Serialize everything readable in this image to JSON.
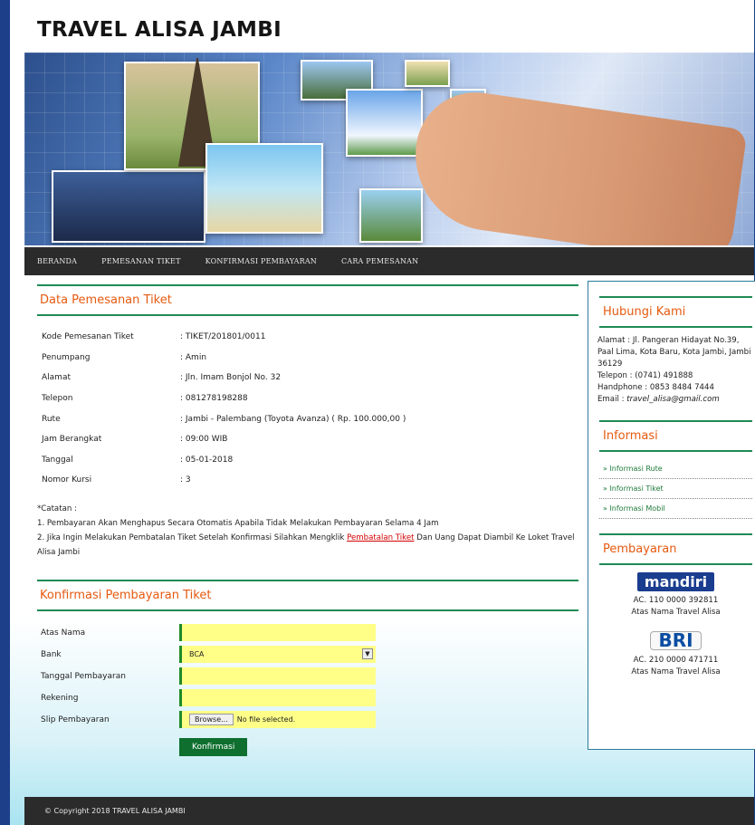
{
  "site": {
    "title": "TRAVEL ALISA JAMBI"
  },
  "nav": {
    "items": [
      "BERANDA",
      "PEMESANAN TIKET",
      "KONFIRMASI PEMBAYARAN",
      "CARA PEMESANAN"
    ]
  },
  "booking": {
    "heading": "Data Pemesanan Tiket",
    "rows": [
      {
        "label": "Kode Pemesanan Tiket",
        "value": ": TIKET/201801/0011"
      },
      {
        "label": "Penumpang",
        "value": ": Amin"
      },
      {
        "label": "Alamat",
        "value": ": Jln. Imam Bonjol No. 32"
      },
      {
        "label": "Telepon",
        "value": ": 081278198288"
      },
      {
        "label": "Rute",
        "value": ": Jambi - Palembang (Toyota Avanza) ( Rp. 100.000,00 )"
      },
      {
        "label": "Jam Berangkat",
        "value": ": 09:00 WIB"
      },
      {
        "label": "Tanggal",
        "value": ": 05-01-2018"
      },
      {
        "label": "Nomor Kursi",
        "value": ": 3"
      }
    ],
    "note_title": "*Catatan :",
    "note_1": "1. Pembayaran Akan Menghapus Secara Otomatis Apabila Tidak Melakukan Pembayaran Selama 4 Jam",
    "note_2_pre": "2. Jika Ingin Melakukan Pembatalan Tiket Setelah Konfirmasi Silahkan Mengklik ",
    "note_2_link": "Pembatalan Tiket",
    "note_2_post": " Dan Uang Dapat Diambil Ke Loket Travel Alisa Jambi"
  },
  "payment_form": {
    "heading": "Konfirmasi Pembayaran Tiket",
    "name_label": "Atas Nama",
    "bank_label": "Bank",
    "bank_value": "BCA",
    "date_label": "Tanggal Pembayaran",
    "account_label": "Rekening",
    "slip_label": "Slip Pembayaran",
    "browse_label": "Browse...",
    "file_status": "No file selected.",
    "submit_label": "Konfirmasi"
  },
  "sidebar": {
    "contact_heading": "Hubungi Kami",
    "address": "Alamat : Jl. Pangeran Hidayat No.39, Paal Lima, Kota Baru, Kota Jambi, Jambi 36129",
    "phone": "Telepon : (0741) 491888",
    "handphone": "Handphone : 0853 8484 7444",
    "email_label": "Email : ",
    "email": "travel_alisa@gmail.com",
    "info_heading": "Informasi",
    "info_links": [
      "» Informasi Rute",
      "» Informasi Tiket",
      "» Informasi Mobil"
    ],
    "payment_heading": "Pembayaran",
    "banks": [
      {
        "logo": "mandiri",
        "account": "AC. 110 0000 392811",
        "holder": "Atas Nama Travel Alisa"
      },
      {
        "logo": "BRI",
        "account": "AC. 210 0000 471711",
        "holder": "Atas Nama Travel Alisa"
      }
    ]
  },
  "footer": {
    "text": "© Copyright 2018 TRAVEL ALISA JAMBI"
  }
}
